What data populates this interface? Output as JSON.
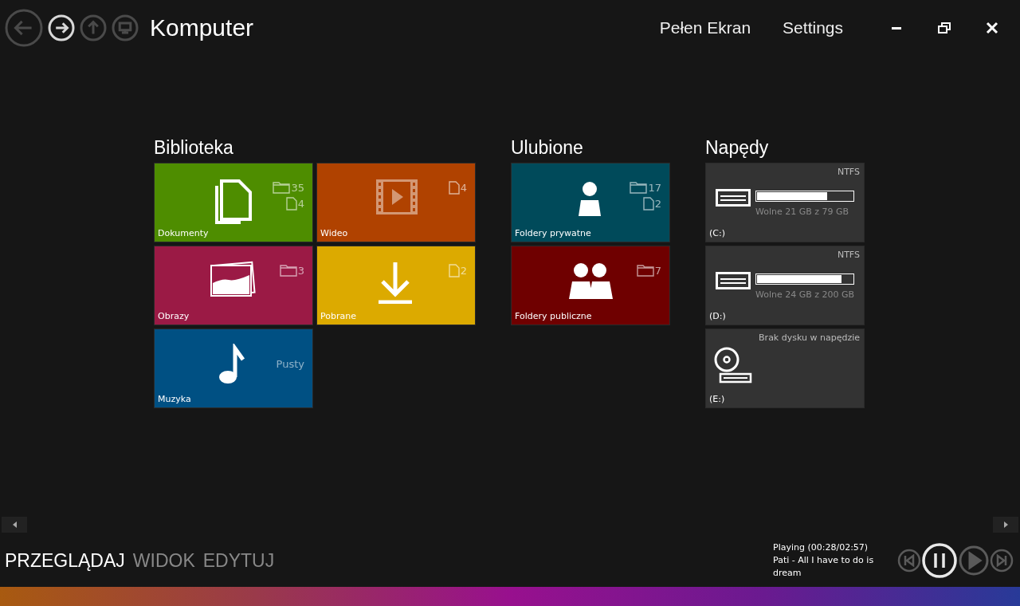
{
  "window": {
    "title": "Komputer"
  },
  "nav_buttons": [
    {
      "kind": "back",
      "disabled": true
    },
    {
      "kind": "forward",
      "disabled": false
    },
    {
      "kind": "up",
      "disabled": true
    },
    {
      "kind": "computer",
      "disabled": true
    }
  ],
  "header_links": [
    "Pełen Ekran",
    "Settings"
  ],
  "window_controls": [
    {
      "kind": "minimize"
    },
    {
      "kind": "restore"
    },
    {
      "kind": "close"
    }
  ],
  "groups": [
    {
      "title": "Biblioteka",
      "tiles": [
        {
          "kind": "documents",
          "label": "Dokumenty",
          "color": "#4e8d00",
          "folders": "35",
          "files": "4"
        },
        {
          "kind": "video",
          "label": "Wideo",
          "color": "#b04200",
          "files": "4"
        },
        {
          "kind": "pictures",
          "label": "Obrazy",
          "color": "#9b1a45",
          "folders": "3"
        },
        {
          "kind": "downloads",
          "label": "Pobrane",
          "color": "#dcaa00",
          "files": "2"
        },
        {
          "kind": "music",
          "label": "Muzyka",
          "color": "#005083",
          "status": "Pusty"
        }
      ]
    },
    {
      "title": "Ulubione",
      "tiles": [
        {
          "kind": "person",
          "label": "Foldery prywatne",
          "color": "#004a5a",
          "folders": "17",
          "files": "2"
        },
        {
          "kind": "people",
          "label": "Foldery publiczne",
          "color": "#6f0000",
          "folders": "7"
        }
      ]
    }
  ],
  "drives": {
    "title": "Napędy",
    "items": [
      {
        "kind": "disk",
        "letter": "(C:)",
        "info": "NTFS",
        "free": "Wolne 21 GB z 79 GB",
        "level": 0.73
      },
      {
        "kind": "disk",
        "letter": "(D:)",
        "info": "NTFS",
        "free": "Wolne 24 GB z 200 GB",
        "level": 0.88
      },
      {
        "kind": "optical",
        "letter": "(E:)",
        "info": "Brak dysku w napędzie"
      }
    ]
  },
  "tabs": [
    {
      "label": "PRZEGLĄDAJ",
      "selected": true
    },
    {
      "label": "WIDOK",
      "selected": false
    },
    {
      "label": "EDYTUJ",
      "selected": false
    }
  ],
  "player": {
    "status": "Playing (00:28/02:57)",
    "track": "Pati - All I have to do is dream",
    "playing": true
  }
}
